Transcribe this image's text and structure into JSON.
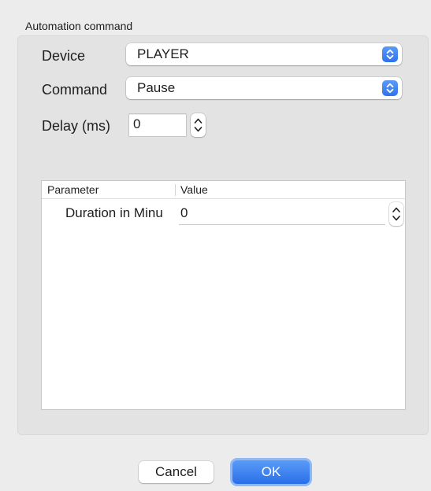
{
  "group": {
    "title": "Automation command"
  },
  "device": {
    "label": "Device",
    "value": "PLAYER"
  },
  "command": {
    "label": "Command",
    "value": "Pause"
  },
  "delay": {
    "label": "Delay (ms)",
    "value": "0"
  },
  "table": {
    "columns": [
      "Parameter",
      "Value"
    ],
    "rows": [
      {
        "parameter": "Duration in Minu",
        "value": "0"
      }
    ]
  },
  "buttons": {
    "cancel": "Cancel",
    "ok": "OK"
  },
  "colors": {
    "accent": "#3b82f6",
    "background": "#ececec",
    "group_background": "#e3e3e3"
  },
  "icons": {
    "popup": "up-down-chevron-icon",
    "stepper": "stepper-arrows-icon"
  }
}
